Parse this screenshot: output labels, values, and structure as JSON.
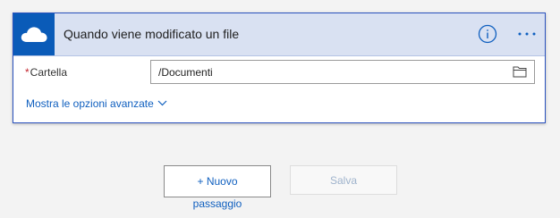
{
  "trigger_card": {
    "title": "Quando viene modificato un file",
    "icon": "onedrive-cloud-icon",
    "accent_color": "#0a5bb8",
    "header_color": "#d9e1f2",
    "actions": {
      "info_icon": "info-icon",
      "more_icon": "ellipsis-icon"
    },
    "field": {
      "required_marker": "*",
      "label": "Cartella",
      "value": "/Documenti",
      "picker_icon": "folder-icon"
    },
    "advanced_link": "Mostra le opzioni avanzate",
    "advanced_icon": "chevron-down-icon"
  },
  "footer": {
    "new_step_top": "+ Nuovo",
    "new_step_bottom": "passaggio",
    "save": "Salva"
  }
}
